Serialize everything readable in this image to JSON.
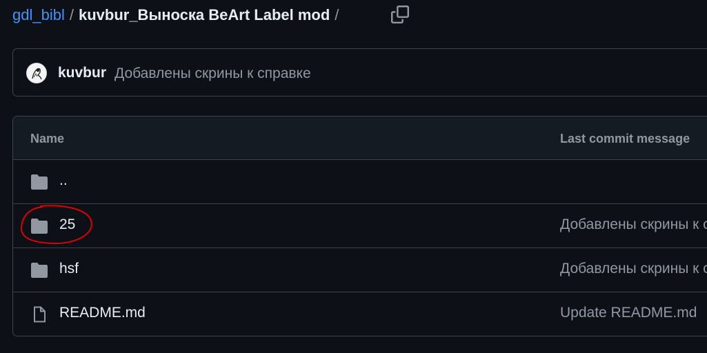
{
  "breadcrumb": {
    "repo": "gdl_bibl",
    "separator": "/",
    "current": "kuvbur_Выноска BeArt Label mod",
    "trailing_separator": "/"
  },
  "commit": {
    "author": "kuvbur",
    "message": "Добавлены скрины к справке"
  },
  "table": {
    "headers": {
      "name": "Name",
      "last_commit_message": "Last commit message"
    },
    "rows": [
      {
        "icon": "folder-icon",
        "name": "..",
        "message": ""
      },
      {
        "icon": "folder-icon",
        "name": "25",
        "message": "Добавлены скрины к справке"
      },
      {
        "icon": "folder-icon",
        "name": "hsf",
        "message": "Добавлены скрины к справке"
      },
      {
        "icon": "file-icon",
        "name": "README.md",
        "message": "Update README.md"
      }
    ]
  },
  "colors": {
    "background": "#0d1117",
    "link": "#4493f8",
    "annotation": "#e00000"
  }
}
